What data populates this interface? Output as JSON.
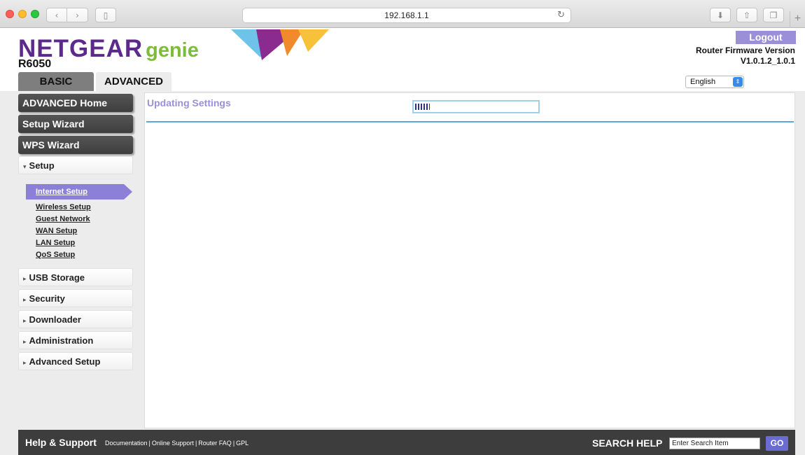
{
  "browser": {
    "url": "192.168.1.1",
    "back_icon": "chevron-left-icon",
    "forward_icon": "chevron-right-icon"
  },
  "header": {
    "brand_name": "NETGEAR",
    "brand_suffix": "genie",
    "model": "R6050",
    "logout_label": "Logout",
    "firmware_label": "Router Firmware Version",
    "firmware_version": "V1.0.1.2_1.0.1",
    "language": "English",
    "tabs": [
      {
        "label": "BASIC",
        "active": false
      },
      {
        "label": "ADVANCED",
        "active": true
      }
    ],
    "colors": {
      "brand": "#5b2a8a",
      "genie": "#7cbc3a",
      "accent": "#9b8fd8"
    }
  },
  "sidebar": {
    "primary": [
      {
        "label": "ADVANCED Home"
      },
      {
        "label": "Setup Wizard"
      },
      {
        "label": "WPS Wizard"
      }
    ],
    "setup": {
      "label": "Setup",
      "expanded": true,
      "items": [
        {
          "label": "Internet Setup",
          "active": true
        },
        {
          "label": "Wireless Setup"
        },
        {
          "label": "Guest Network"
        },
        {
          "label": "WAN Setup"
        },
        {
          "label": "LAN Setup"
        },
        {
          "label": "QoS Setup"
        }
      ]
    },
    "sections": [
      {
        "label": "USB Storage"
      },
      {
        "label": "Security"
      },
      {
        "label": "Downloader"
      },
      {
        "label": "Administration"
      },
      {
        "label": "Advanced Setup"
      }
    ]
  },
  "main": {
    "title": "Updating Settings",
    "progress_fraction": 0.12
  },
  "footer": {
    "help_title": "Help & Support",
    "links": [
      "Documentation",
      "Online Support",
      "Router FAQ",
      "GPL"
    ],
    "search_label": "SEARCH HELP",
    "search_placeholder": "Enter Search Item",
    "go_label": "GO"
  }
}
